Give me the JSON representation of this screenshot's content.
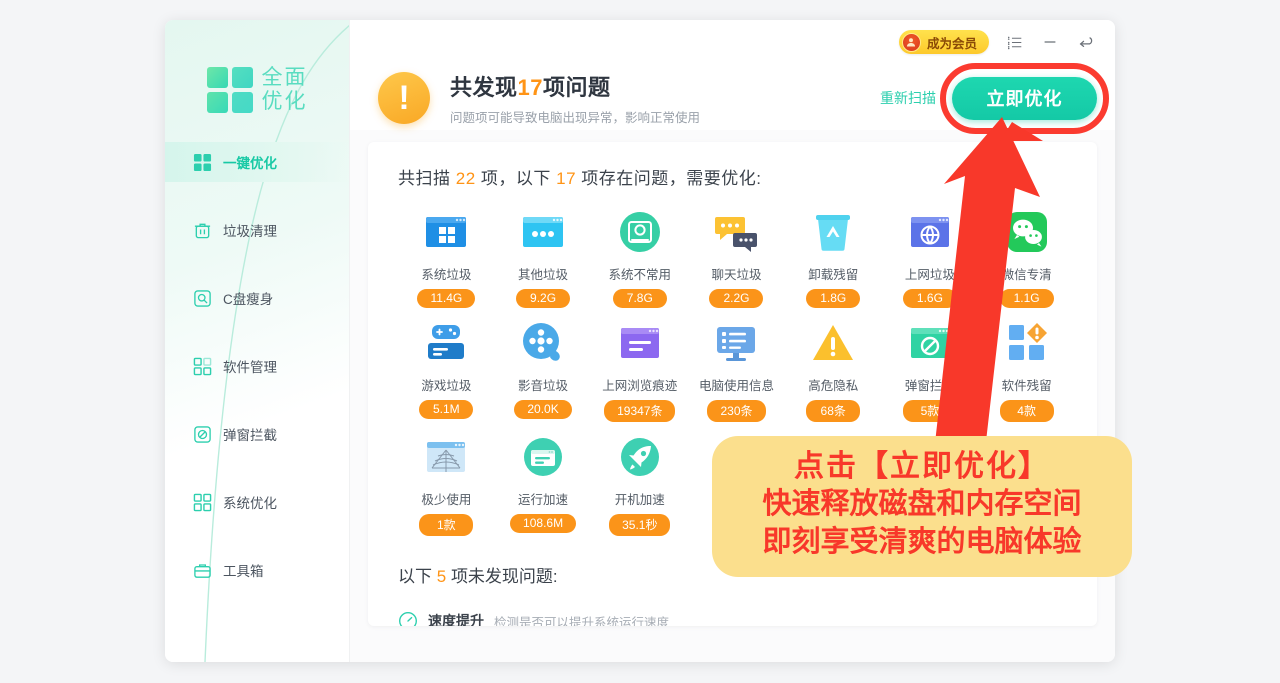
{
  "window": {
    "logo_text_line1": "全面",
    "logo_text_line2": "优化"
  },
  "topbar": {
    "vip_label": "成为会员",
    "menu_icon": "list-icon",
    "minimize_icon": "minimize-icon",
    "restore_icon": "undo-icon"
  },
  "sidebar": {
    "items": [
      {
        "label": "一键优化",
        "icon": "grid-squares-icon",
        "active": true
      },
      {
        "label": "垃圾清理",
        "icon": "trash-icon",
        "active": false
      },
      {
        "label": "C盘瘦身",
        "icon": "disk-search-icon",
        "active": false
      },
      {
        "label": "软件管理",
        "icon": "app-grid-icon",
        "active": false
      },
      {
        "label": "弹窗拦截",
        "icon": "block-icon",
        "active": false
      },
      {
        "label": "系统优化",
        "icon": "grid-squares-icon",
        "active": false
      },
      {
        "label": "工具箱",
        "icon": "toolbox-icon",
        "active": false
      }
    ]
  },
  "header": {
    "title_prefix": "共发现",
    "title_count": "17",
    "title_suffix": "项问题",
    "subtitle": "问题项可能导致电脑出现异常，影响正常使用",
    "rescan_label": "重新扫描",
    "optimize_label": "立即优化"
  },
  "card": {
    "scan_prefix": "共扫描",
    "scan_total": "22",
    "scan_mid": "项，以下",
    "scan_issues": "17",
    "scan_suffix": "项存在问题，需要优化:",
    "items": [
      {
        "name": "系统垃圾",
        "value": "11.4G",
        "icon": "windows-window-icon"
      },
      {
        "name": "其他垃圾",
        "value": "9.2G",
        "icon": "dots-window-icon"
      },
      {
        "name": "系统不常用",
        "value": "7.8G",
        "icon": "hdd-circle-icon"
      },
      {
        "name": "聊天垃圾",
        "value": "2.2G",
        "icon": "chat-bubbles-icon"
      },
      {
        "name": "卸载残留",
        "value": "1.8G",
        "icon": "recycle-bin-icon"
      },
      {
        "name": "上网垃圾",
        "value": "1.6G",
        "icon": "globe-window-icon"
      },
      {
        "name": "微信专清",
        "value": "1.1G",
        "icon": "wechat-icon"
      },
      {
        "name": "游戏垃圾",
        "value": "5.1M",
        "icon": "gamepad-icon"
      },
      {
        "name": "影音垃圾",
        "value": "20.0K",
        "icon": "film-reel-icon"
      },
      {
        "name": "上网浏览痕迹",
        "value": "19347条",
        "icon": "purple-window-icon"
      },
      {
        "name": "电脑使用信息",
        "value": "230条",
        "icon": "monitor-list-icon"
      },
      {
        "name": "高危隐私",
        "value": "68条",
        "icon": "warning-triangle-icon"
      },
      {
        "name": "弹窗拦截",
        "value": "5款",
        "icon": "popup-block-icon"
      },
      {
        "name": "软件残留",
        "value": "4款",
        "icon": "squares-alert-icon"
      },
      {
        "name": "极少使用",
        "value": "1款",
        "icon": "cobweb-window-icon"
      },
      {
        "name": "运行加速",
        "value": "108.6M",
        "icon": "speed-window-icon"
      },
      {
        "name": "开机加速",
        "value": "35.1秒",
        "icon": "rocket-icon"
      }
    ],
    "ok_prefix": "以下",
    "ok_count": "5",
    "ok_suffix": "项未发现问题:",
    "ok_items": [
      {
        "name": "速度提升",
        "desc": "检测是否可以提升系统运行速度",
        "icon": "speedometer-icon"
      }
    ]
  },
  "annotation": {
    "line1": "点击【立即优化】",
    "line2": "快速释放磁盘和内存空间",
    "line3": "即刻享受清爽的电脑体验",
    "arrow_color": "#f8382a",
    "callout_bg": "#fbdf8d",
    "text_color": "#f8382a",
    "highlight_color": "#fb3b30"
  },
  "colors": {
    "brand_green": "#2ccfae",
    "accent_orange": "#ff9416",
    "badge_orange": "#fb9419"
  }
}
